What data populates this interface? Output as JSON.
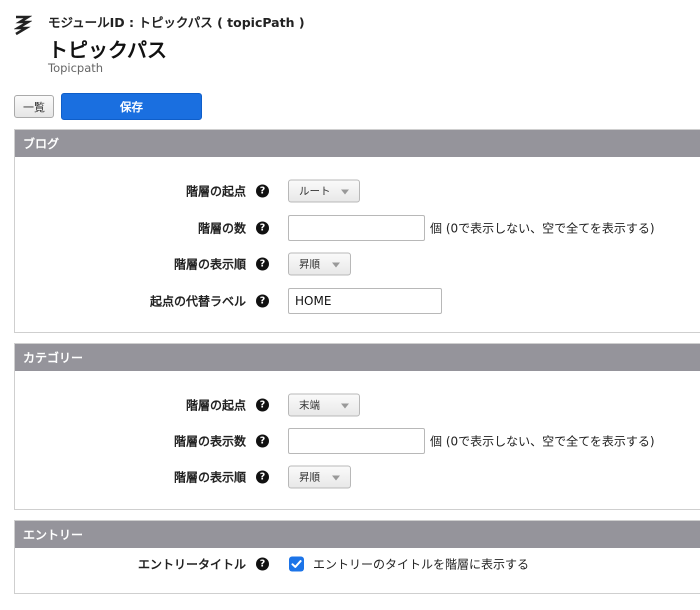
{
  "header": {
    "module_id_text": "モジュールID : トピックパス ( topicPath )",
    "title": "トピックパス",
    "subtitle": "Topicpath",
    "icon": "topicpath-module-icon"
  },
  "toolbar": {
    "list_label": "一覧",
    "save_label": "保存"
  },
  "sections": {
    "blog": {
      "title": "ブログ",
      "level_start": {
        "label": "階層の起点",
        "value": "ルート"
      },
      "level_count": {
        "label": "階層の数",
        "value": "",
        "hint": "個 (0で表示しない、空で全てを表示する)"
      },
      "level_order": {
        "label": "階層の表示順",
        "value": "昇順"
      },
      "start_label": {
        "label": "起点の代替ラベル",
        "value": "HOME"
      }
    },
    "category": {
      "title": "カテゴリー",
      "level_start": {
        "label": "階層の起点",
        "value": "末端"
      },
      "level_display_count": {
        "label": "階層の表示数",
        "value": "",
        "hint": "個 (0で表示しない、空で全てを表示する)"
      },
      "level_order": {
        "label": "階層の表示順",
        "value": "昇順"
      }
    },
    "entry": {
      "title": "エントリー",
      "entry_title": {
        "label": "エントリータイトル",
        "checkbox_label": "エントリーのタイトルを階層に表示する",
        "checked": true
      }
    }
  },
  "help_glyph": "?",
  "colors": {
    "section_header_bg": "#95949b",
    "primary_button": "#1a6fe0",
    "checkbox": "#1c74e8"
  }
}
